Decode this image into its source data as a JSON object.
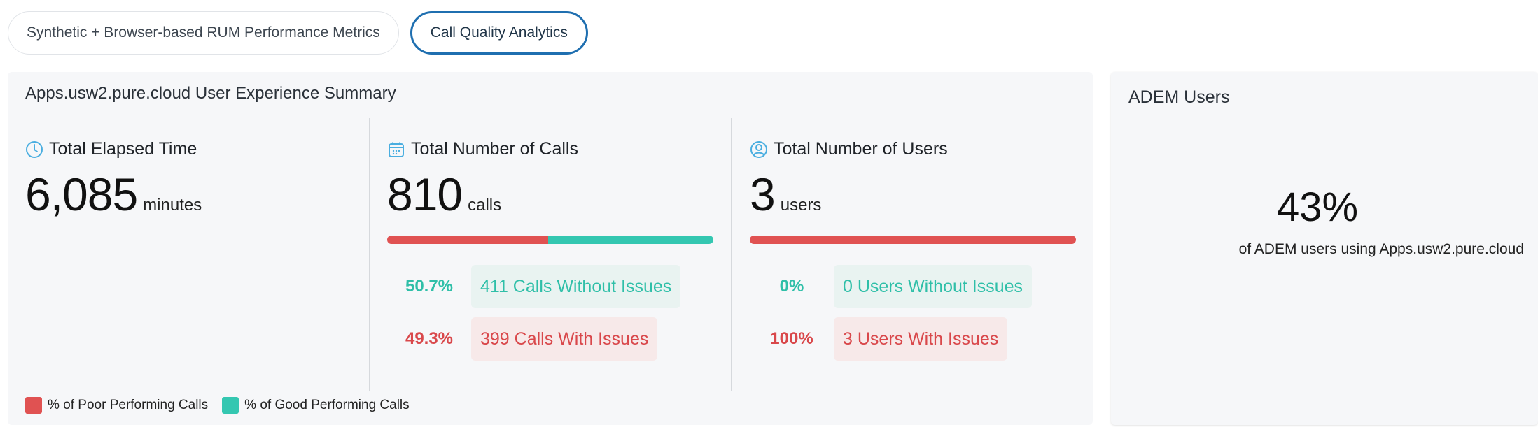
{
  "tabs": [
    {
      "label": "Synthetic + Browser-based RUM Performance Metrics",
      "active": false
    },
    {
      "label": "Call Quality Analytics",
      "active": true
    }
  ],
  "summary": {
    "title": "Apps.usw2.pure.cloud User Experience Summary",
    "elapsed": {
      "label": "Total Elapsed Time",
      "value": "6,085",
      "unit": "minutes",
      "icon": "clock-icon"
    },
    "calls": {
      "label": "Total Number of Calls",
      "value": "810",
      "unit": "calls",
      "icon": "calendar-icon",
      "bar": {
        "poor_fraction": 0.493,
        "good_fraction": 0.507
      },
      "good_pct": "50.7%",
      "good_label": "411 Calls Without Issues",
      "bad_pct": "49.3%",
      "bad_label": "399 Calls With Issues"
    },
    "users": {
      "label": "Total Number of Users",
      "value": "3",
      "unit": "users",
      "icon": "user-icon",
      "bar": {
        "poor_fraction": 1.0,
        "good_fraction": 0.0
      },
      "good_pct": "0%",
      "good_label": "0 Users Without Issues",
      "bad_pct": "100%",
      "bad_label": "3 Users With Issues"
    },
    "legend": {
      "poor": "% of Poor Performing Calls",
      "good": "% of Good Performing Calls"
    }
  },
  "adem": {
    "title": "ADEM Users",
    "percent": "43%",
    "subtitle": "of ADEM users using Apps.usw2.pure.cloud"
  },
  "colors": {
    "poor": "#e05252",
    "good": "#34c7b1",
    "accent": "#1f6fb0"
  }
}
